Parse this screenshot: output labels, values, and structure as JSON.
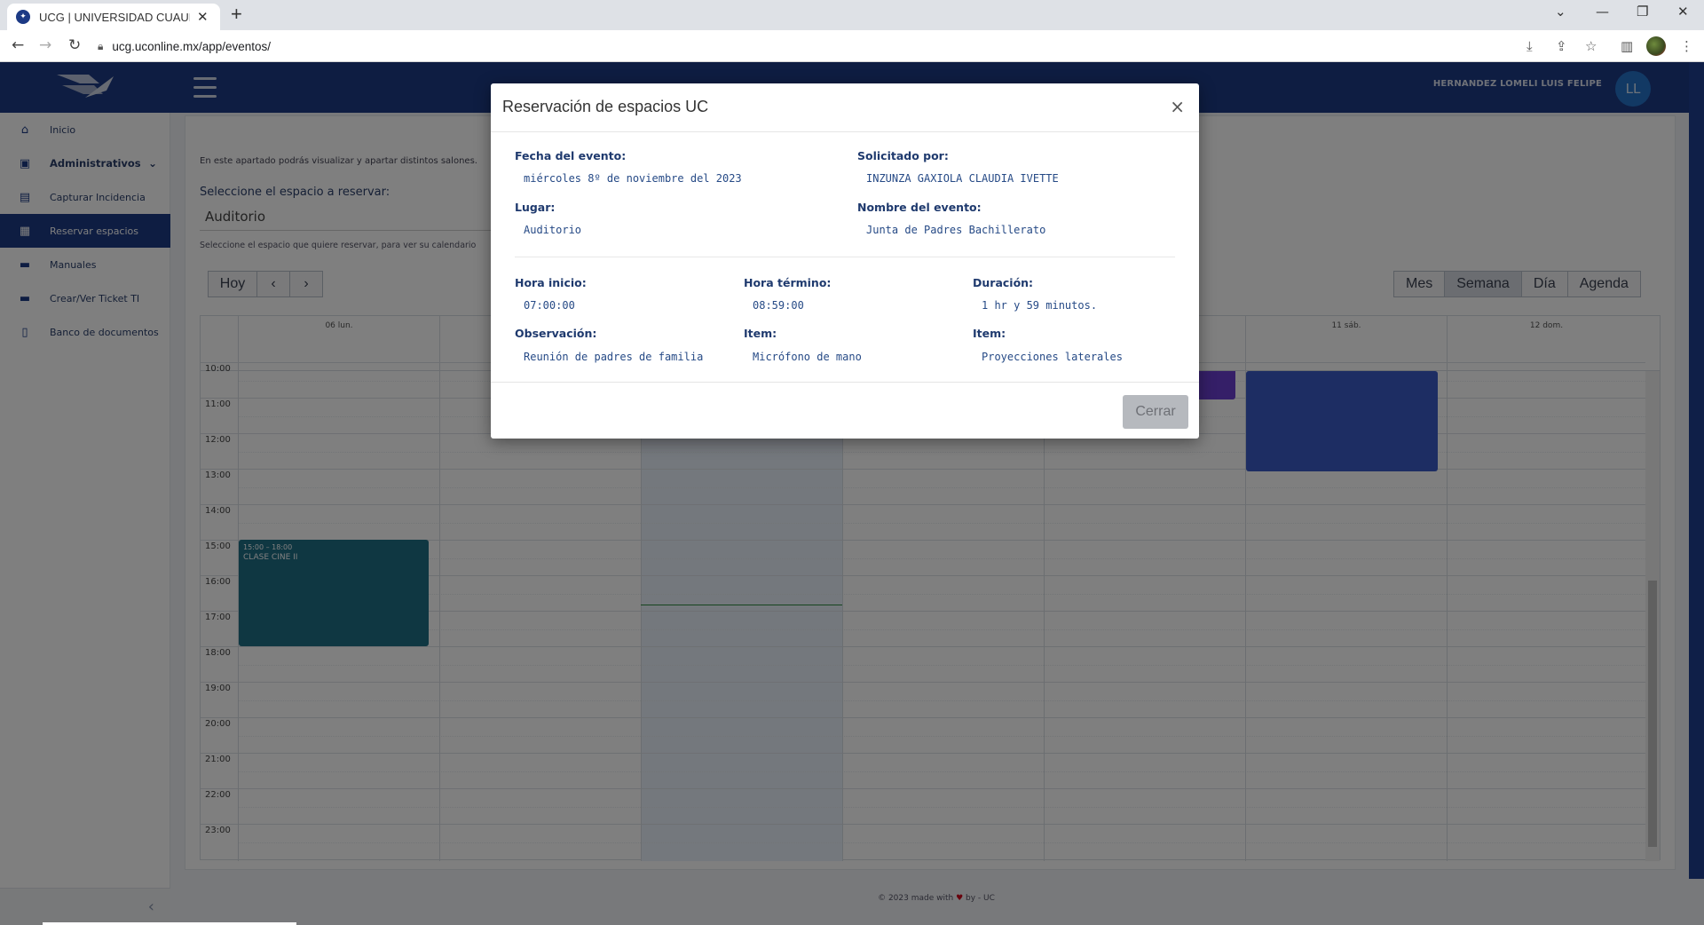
{
  "browser": {
    "tab_title": "UCG | UNIVERSIDAD CUAUHTÉMOC",
    "url": "ucg.uconline.mx/app/eventos/"
  },
  "header": {
    "user_name": "HERNANDEZ LOMELI LUIS FELIPE",
    "avatar_initials": "LL"
  },
  "sidebar": {
    "items": [
      {
        "label": "Inicio",
        "icon": "home-icon"
      },
      {
        "label": "Administrativos",
        "icon": "briefcase-icon"
      },
      {
        "label": "Capturar Incidencia",
        "icon": "calendar-plus-icon"
      },
      {
        "label": "Reservar espacios",
        "icon": "calendar-icon"
      },
      {
        "label": "Manuales",
        "icon": "book-icon"
      },
      {
        "label": "Crear/Ver Ticket TI",
        "icon": "book-icon"
      },
      {
        "label": "Banco de documentos",
        "icon": "file-icon"
      }
    ]
  },
  "page": {
    "intro": "En este apartado podrás visualizar y apartar distintos salones.",
    "select_label": "Seleccione el espacio a reservar:",
    "select_value": "Auditorio",
    "select_help": "Seleccione el espacio que quiere reservar, para ver su calendario"
  },
  "calendar": {
    "nav_today": "Hoy",
    "views": [
      "Mes",
      "Semana",
      "Día",
      "Agenda"
    ],
    "active_view": "Semana",
    "day_labels": [
      "06 lun.",
      "",
      "",
      "",
      "",
      "11 sáb.",
      "12 dom."
    ],
    "hour_labels": [
      "10:00",
      "11:00",
      "12:00",
      "13:00",
      "14:00",
      "15:00",
      "16:00",
      "17:00",
      "18:00",
      "19:00",
      "20:00",
      "21:00",
      "22:00",
      "23:00"
    ],
    "events": [
      {
        "time": "15:00 – 18:00",
        "title": "CLASE CINE II",
        "color": "#1f6e85"
      }
    ]
  },
  "footer": {
    "text_before": "© 2023 made with",
    "text_after": "by - UC"
  },
  "modal": {
    "title": "Reservación de espacios UC",
    "fecha_label": "Fecha del evento:",
    "fecha_value": "miércoles 8º de noviembre del 2023",
    "solicitado_label": "Solicitado por:",
    "solicitado_value": "INZUNZA GAXIOLA CLAUDIA IVETTE",
    "lugar_label": "Lugar:",
    "lugar_value": "Auditorio",
    "nombre_label": "Nombre del evento:",
    "nombre_value": "Junta de Padres Bachillerato",
    "hora_inicio_label": "Hora inicio:",
    "hora_inicio_value": "07:00:00",
    "hora_termino_label": "Hora término:",
    "hora_termino_value": "08:59:00",
    "duracion_label": "Duración:",
    "duracion_value": "1 hr y 59 minutos.",
    "observacion_label": "Observación:",
    "observacion_value": "Reunión de padres de familia",
    "item1_label": "Item:",
    "item1_value": "Micrófono de mano",
    "item2_label": "Item:",
    "item2_value": "Proyecciones laterales",
    "close_button": "Cerrar"
  },
  "colors": {
    "brand": "#1c3a85",
    "event_teal": "#1f6e85",
    "event_blue": "#3a5bc7",
    "event_purple": "#6a3fd0"
  }
}
